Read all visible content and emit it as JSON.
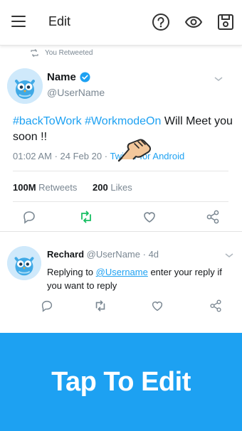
{
  "topbar": {
    "title": "Edit",
    "icons": [
      "menu-icon",
      "help-icon",
      "preview-eye-icon",
      "save-icon"
    ]
  },
  "tweet": {
    "retweet_label": "You Retweeted",
    "name": "Name",
    "handle": "@UserName",
    "hashtag1": "#backToWork",
    "hashtag2": "#WorkmodeOn",
    "text_rest": " Will Meet you soon !!",
    "time": "01:02 AM",
    "date": "24 Feb 20",
    "source": "Twitter for Android",
    "retweets_count": "100M",
    "retweets_label": "Retweets",
    "likes_count": "200",
    "likes_label": "Likes",
    "meta_sep": "·"
  },
  "reply": {
    "name": "Rechard",
    "handle": "@UserName",
    "age": "4d",
    "replying_to": "Replying to",
    "mention": "@Username",
    "text_rest": " enter your reply if you want to reply"
  },
  "banner": {
    "label": "Tap To Edit"
  },
  "colors": {
    "accent": "#1da1f2",
    "retweet_green": "#17bf63",
    "muted": "#7a8792"
  }
}
